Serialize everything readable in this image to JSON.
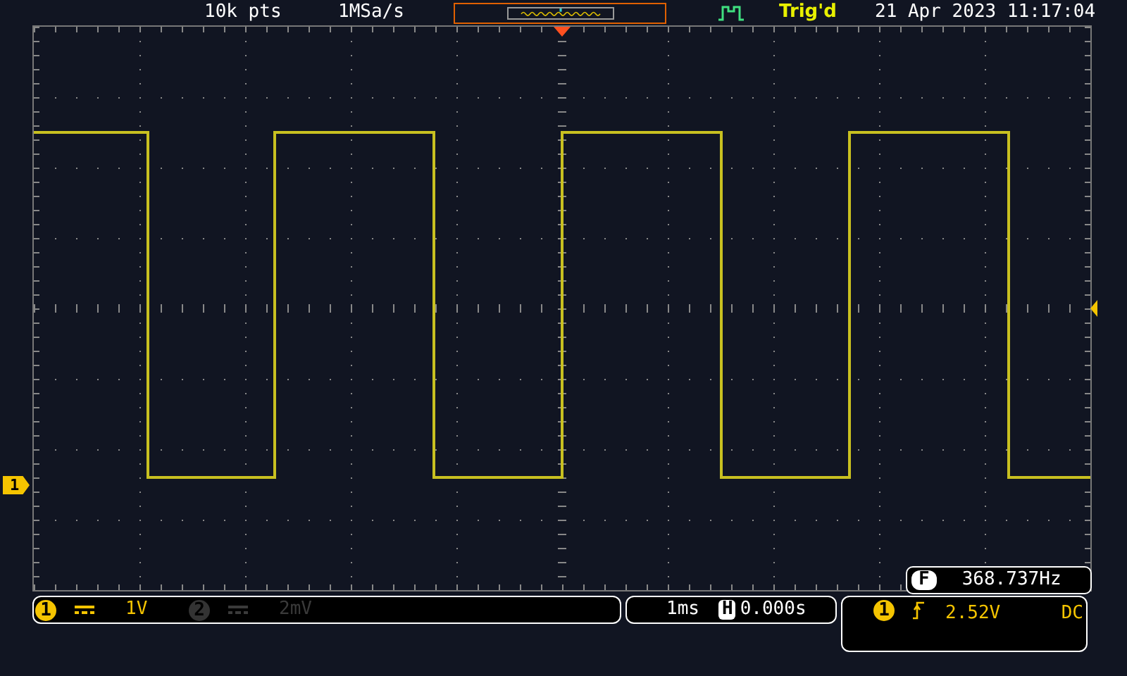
{
  "top_bar": {
    "record_length": "10k pts",
    "sample_rate": "1MSa/s",
    "trigger_status": "Trig'd",
    "datetime": "21 Apr 2023 11:17:04"
  },
  "channel_marker": "1",
  "channels": [
    {
      "number": "1",
      "scale": "1V",
      "enabled": true
    },
    {
      "number": "2",
      "scale": "2mV",
      "enabled": false
    }
  ],
  "frequency": {
    "label": "F",
    "value": "368.737Hz"
  },
  "timebase": {
    "scale": "1ms",
    "position_label": "H",
    "position": "0.000s"
  },
  "trigger": {
    "source": "1",
    "level": "2.52V",
    "coupling": "DC"
  }
}
